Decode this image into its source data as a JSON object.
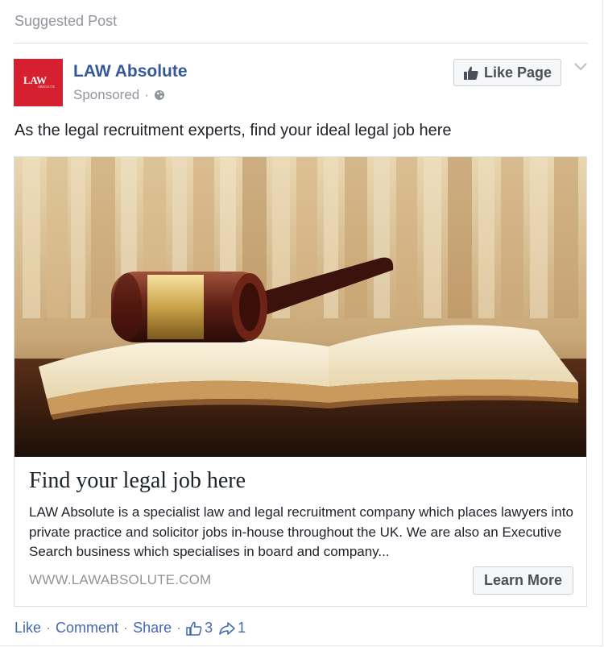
{
  "header": {
    "suggested_label": "Suggested Post"
  },
  "page": {
    "name": "LAW Absolute",
    "logo_text": "LAW",
    "logo_subtext": "ABSOLUTE",
    "sponsored_label": "Sponsored",
    "sponsored_separator": "·",
    "like_page_label": "Like Page"
  },
  "post": {
    "text": "As the legal recruitment experts, find your ideal legal job here"
  },
  "ad": {
    "title": "Find your legal job here",
    "description": "LAW Absolute is a specialist law and legal recruitment company which places lawyers into private practice and solicitor jobs in-house throughout the UK. We are also an Executive Search business which specialises in board and company...",
    "url": "WWW.LAWABSOLUTE.COM",
    "cta_label": "Learn More"
  },
  "actions": {
    "like": "Like",
    "comment": "Comment",
    "share": "Share",
    "separator": "·",
    "likes_count": "3",
    "shares_count": "1"
  },
  "colors": {
    "link": "#365899",
    "brand_red": "#d6202f",
    "meta_gray": "#90949c",
    "action_blue": "#4267b2"
  },
  "icons": [
    "globe-icon",
    "thumbs-up-icon",
    "chevron-down-icon",
    "like-count-icon",
    "share-count-icon"
  ]
}
